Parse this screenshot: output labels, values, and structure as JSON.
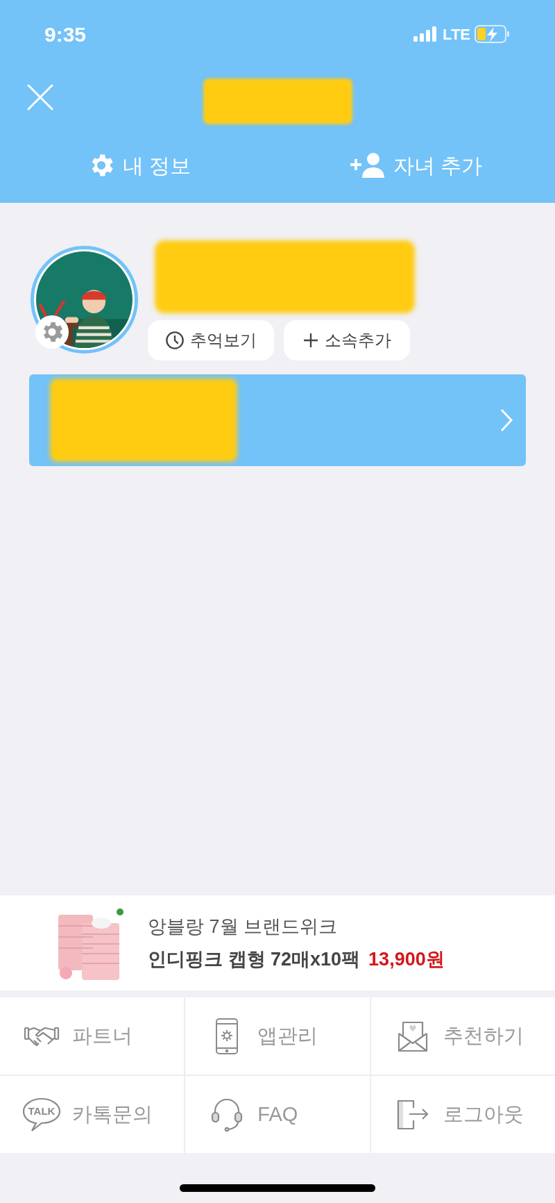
{
  "status_bar": {
    "time": "9:35",
    "network": "LTE"
  },
  "header": {
    "actions": [
      {
        "kind": "settings",
        "label": "내 정보"
      },
      {
        "kind": "add-person",
        "label": "자녀 추가"
      }
    ]
  },
  "profile": {
    "buttons": [
      {
        "kind": "clock",
        "label": "추억보기"
      },
      {
        "kind": "plus",
        "label": "소속추가"
      }
    ]
  },
  "ad": {
    "title": "앙블랑 7월 브랜드위크",
    "product": "인디핑크 캡형 72매x10팩",
    "price": "13,900원"
  },
  "menu": [
    {
      "kind": "handshake",
      "label": "파트너"
    },
    {
      "kind": "phone",
      "label": "앱관리"
    },
    {
      "kind": "envelope",
      "label": "추천하기"
    },
    {
      "kind": "talk",
      "label": "카톡문의",
      "icon_text": "TALK"
    },
    {
      "kind": "headset",
      "label": "FAQ"
    },
    {
      "kind": "logout",
      "label": "로그아웃"
    }
  ]
}
